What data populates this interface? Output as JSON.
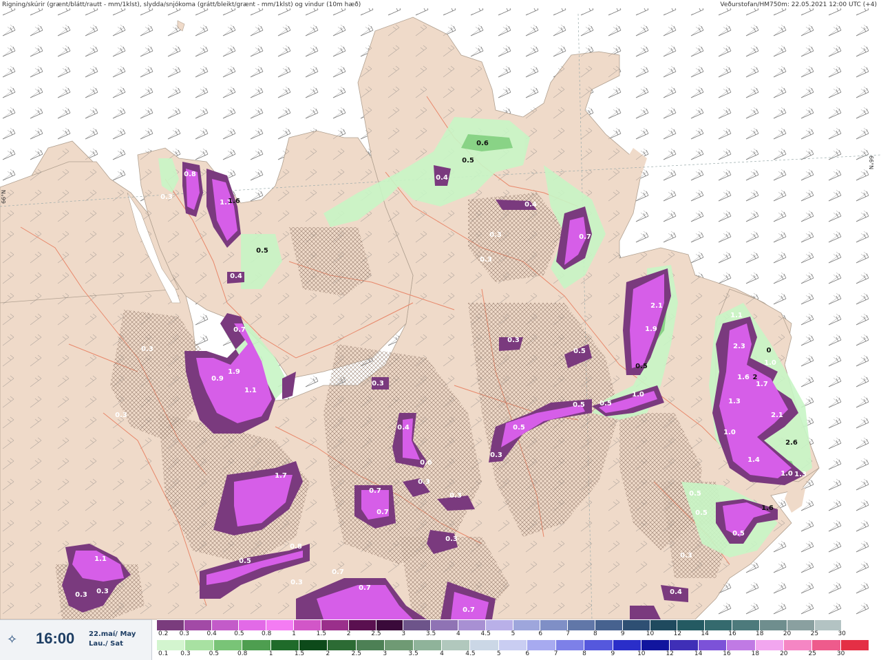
{
  "header": {
    "left": "Rigning/skúrir (grænt/blátt/rautt - mm/1klst), slydda/snjókoma (grátt/bleikt/grænt - mm/1klst) og vindur (10m hæð)",
    "right": "Veðurstofan/HM750m: 22.05.2021 12:00 UTC (+4)"
  },
  "lat_labels": {
    "left": "66°N",
    "right": "66°N"
  },
  "time_box": {
    "time": "16:00",
    "date_line1": "22.maí/ May",
    "date_line2": "Lau./ Sat",
    "icon": "wind-sparkle-icon"
  },
  "colors": {
    "sea": "#ffffff",
    "land": "#efdac9",
    "roads": "#e8876a",
    "rain_light": "#c8f5c5",
    "snow": "#d65ee8",
    "snow_dark": "#7a3a7e"
  },
  "legend": {
    "snow_scale": {
      "labels": [
        "0.2",
        "0.3",
        "0.4",
        "0.5",
        "0.8",
        "1",
        "1.5",
        "2",
        "2.5",
        "3",
        "3.5",
        "4",
        "4.5",
        "5",
        "6",
        "7",
        "8",
        "9",
        "10",
        "12",
        "14",
        "16",
        "18",
        "20",
        "25",
        "30"
      ],
      "colors": [
        "#7a3c7d",
        "#a24aa6",
        "#c35bc9",
        "#e26ae7",
        "#f47cf3",
        "#d256c8",
        "#9a2f8b",
        "#5a1050",
        "#3a0a3a",
        "#6d548a",
        "#8f73b4",
        "#a890d3",
        "#b9b0e8",
        "#9ea6dc",
        "#7f8fc6",
        "#6177a8",
        "#47628f",
        "#2e4f73",
        "#1f4a5e",
        "#245a62",
        "#356a6e",
        "#4d7a7c",
        "#6f8e8e",
        "#8aa0a0",
        "#b3c3c3",
        "#ffffff"
      ]
    },
    "rain_scale": {
      "labels": [
        "0.1",
        "0.3",
        "0.5",
        "0.8",
        "1",
        "1.5",
        "2",
        "2.5",
        "3",
        "3.5",
        "4",
        "4.5",
        "5",
        "6",
        "7",
        "8",
        "9",
        "10",
        "12",
        "14",
        "16",
        "18",
        "20",
        "25",
        "30"
      ],
      "colors": [
        "#d3f5cf",
        "#a8e1a2",
        "#79c477",
        "#4e9e50",
        "#1f6b2a",
        "#0d4a1a",
        "#2c6b34",
        "#4d8055",
        "#6f9a74",
        "#8fb39a",
        "#b1c8bd",
        "#cbd7e6",
        "#c9cdf2",
        "#a7aaf0",
        "#7d80e8",
        "#5558dd",
        "#2a2ec9",
        "#11159e",
        "#3f2fb7",
        "#7c52d8",
        "#c07ae4",
        "#f2a6ef",
        "#f586c4",
        "#ee5b8c",
        "#e42f45"
      ]
    }
  },
  "map_labels": [
    {
      "v": "0.8",
      "dark": false
    },
    {
      "v": "1.7",
      "dark": false
    },
    {
      "v": "1.6",
      "dark": true
    },
    {
      "v": "0.3",
      "dark": false
    },
    {
      "v": "0.5",
      "dark": true
    },
    {
      "v": "0.4",
      "dark": false
    },
    {
      "v": "0.7",
      "dark": false
    },
    {
      "v": "0.9",
      "dark": false
    },
    {
      "v": "1.9",
      "dark": false
    },
    {
      "v": "1.1",
      "dark": false
    },
    {
      "v": "0.3",
      "dark": false
    },
    {
      "v": "0.3",
      "dark": false
    },
    {
      "v": "0.6",
      "dark": true
    },
    {
      "v": "0.5",
      "dark": true
    },
    {
      "v": "0.4",
      "dark": false
    },
    {
      "v": "0.4",
      "dark": false
    },
    {
      "v": "0.7",
      "dark": false
    },
    {
      "v": "0.3",
      "dark": false
    },
    {
      "v": "0.3",
      "dark": false
    },
    {
      "v": "0.5",
      "dark": false
    },
    {
      "v": "0.3",
      "dark": false
    },
    {
      "v": "0.4",
      "dark": false
    },
    {
      "v": "0.5",
      "dark": false
    },
    {
      "v": "0.3",
      "dark": false
    },
    {
      "v": "0.5",
      "dark": false
    },
    {
      "v": "0.5",
      "dark": false
    },
    {
      "v": "1.0",
      "dark": false
    },
    {
      "v": "2.1",
      "dark": false
    },
    {
      "v": "1.9",
      "dark": false
    },
    {
      "v": "0.5",
      "dark": true
    },
    {
      "v": "1.7",
      "dark": false
    },
    {
      "v": "0.7",
      "dark": false
    },
    {
      "v": "0.7",
      "dark": false
    },
    {
      "v": "0.3",
      "dark": false
    },
    {
      "v": "0.3",
      "dark": false
    },
    {
      "v": "0.3",
      "dark": false
    },
    {
      "v": "0.8",
      "dark": false
    },
    {
      "v": "0.5",
      "dark": false
    },
    {
      "v": "0.7",
      "dark": false
    },
    {
      "v": "0.7",
      "dark": false
    },
    {
      "v": "0.3",
      "dark": false
    },
    {
      "v": "0.7",
      "dark": false
    },
    {
      "v": "1.1",
      "dark": false
    },
    {
      "v": "0.3",
      "dark": false
    },
    {
      "v": "0.3",
      "dark": false
    },
    {
      "v": "0.3",
      "dark": false
    },
    {
      "v": "2.3",
      "dark": false
    },
    {
      "v": "1.6",
      "dark": false
    },
    {
      "v": "1.3",
      "dark": false
    },
    {
      "v": "2.1",
      "dark": false
    },
    {
      "v": "1.0",
      "dark": false
    },
    {
      "v": "1.4",
      "dark": false
    },
    {
      "v": "1.0",
      "dark": false
    },
    {
      "v": "1.3",
      "dark": false
    },
    {
      "v": "1.6",
      "dark": true
    },
    {
      "v": "0.5",
      "dark": false
    },
    {
      "v": "0.5",
      "dark": false
    },
    {
      "v": "0.5",
      "dark": false
    },
    {
      "v": "0.3",
      "dark": false
    },
    {
      "v": "0.4",
      "dark": false
    },
    {
      "v": "0.6",
      "dark": false
    },
    {
      "v": "2.6",
      "dark": true
    },
    {
      "v": "1.0",
      "dark": false
    },
    {
      "v": "1.7",
      "dark": false
    },
    {
      "v": "0",
      "dark": true
    },
    {
      "v": "2",
      "dark": true
    },
    {
      "v": "1.1",
      "dark": false
    }
  ]
}
